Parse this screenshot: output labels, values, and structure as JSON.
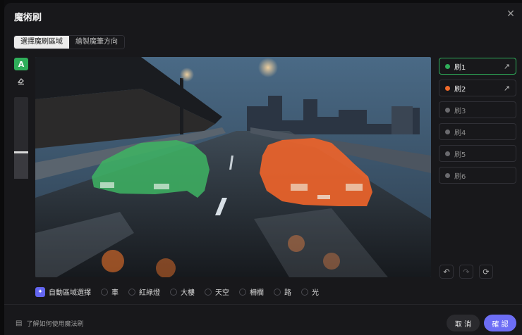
{
  "dialog": {
    "title": "魔術刷"
  },
  "tabs": [
    {
      "label": "選擇魔刷區域",
      "active": true
    },
    {
      "label": "繪製魔筆方向",
      "active": false
    }
  ],
  "tools": {
    "brush_glyph": "A",
    "eraser_icon": "eraser-icon",
    "size_slider_level": 0.32
  },
  "brushes": [
    {
      "label": "刷1",
      "color": "#2fae5a",
      "active": true,
      "has_arrow": true
    },
    {
      "label": "刷2",
      "color": "#f06a2a",
      "active": false,
      "has_arrow": true
    },
    {
      "label": "刷3",
      "color": "#6a6a6e",
      "active": false,
      "has_arrow": false
    },
    {
      "label": "刷4",
      "color": "#6a6a6e",
      "active": false,
      "has_arrow": false
    },
    {
      "label": "刷5",
      "color": "#6a6a6e",
      "active": false,
      "has_arrow": false
    },
    {
      "label": "刷6",
      "color": "#6a6a6e",
      "active": false,
      "has_arrow": false
    }
  ],
  "history": {
    "undo": "↶",
    "redo": "↷",
    "reset": "⟳"
  },
  "auto_select": {
    "label": "自動區域選擇",
    "options": [
      "車",
      "紅綠燈",
      "大樓",
      "天空",
      "柵欄",
      "路",
      "光"
    ]
  },
  "footer": {
    "help": "了解如何使用魔法刷",
    "cancel": "取 消",
    "confirm": "確 認"
  },
  "colors": {
    "accent": "#6d6ef5",
    "brush1": "#2fae5a",
    "brush2": "#f06a2a"
  }
}
